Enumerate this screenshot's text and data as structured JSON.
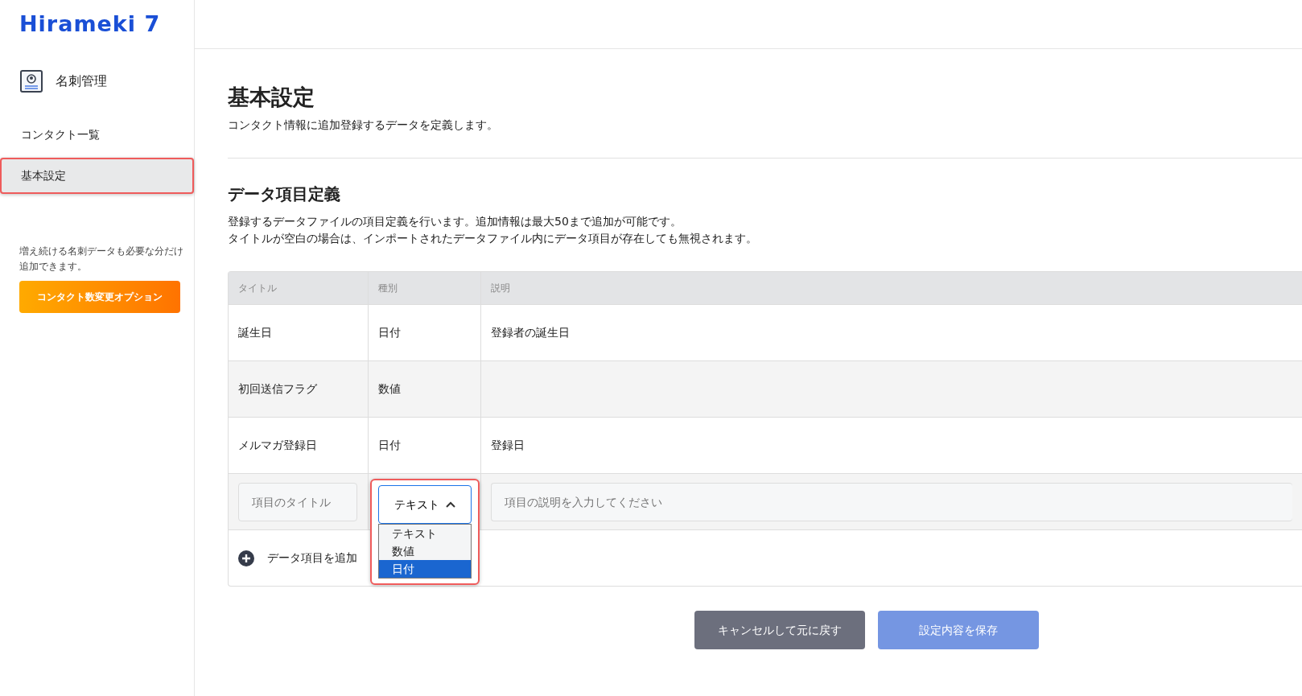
{
  "sidebar": {
    "logo": "Hirameki 7",
    "section": "名刺管理",
    "items": [
      {
        "label": "コンタクト一覧",
        "selected": false,
        "highlighted": false
      },
      {
        "label": "基本設定",
        "selected": true,
        "highlighted": true
      }
    ],
    "promo_text": "増え続ける名刺データも必要な分だけ追加できます。",
    "promo_button": "コンタクト数変更オプション"
  },
  "page": {
    "title": "基本設定",
    "subtitle": "コンタクト情報に追加登録するデータを定義します。"
  },
  "section": {
    "title": "データ項目定義",
    "description": [
      "登録するデータファイルの項目定義を行います。追加情報は最大50まで追加が可能です。",
      "タイトルが空白の場合は、インポートされたデータファイル内にデータ項目が存在しても無視されます。"
    ]
  },
  "table": {
    "columns": [
      "タイトル",
      "種別",
      "説明"
    ],
    "rows": [
      [
        "誕生日",
        "日付",
        "登録者の誕生日"
      ],
      [
        "初回送信フラグ",
        "数値",
        ""
      ],
      [
        "メルマガ登録日",
        "日付",
        "登録日"
      ]
    ],
    "new_row": {
      "title_placeholder": "項目のタイトル",
      "type_value": "テキスト",
      "type_expanded": true,
      "type_highlighted": true,
      "options": [
        {
          "label": "テキスト",
          "selected": false
        },
        {
          "label": "数値",
          "selected": false
        },
        {
          "label": "日付",
          "selected": true
        }
      ],
      "description_placeholder": "項目の説明を入力してください"
    },
    "add_label": "データ項目を追加"
  },
  "buttons": [
    {
      "label": "キャンセルして元に戻す",
      "disabled": false
    },
    {
      "label": "設定内容を保存",
      "disabled": true
    }
  ]
}
